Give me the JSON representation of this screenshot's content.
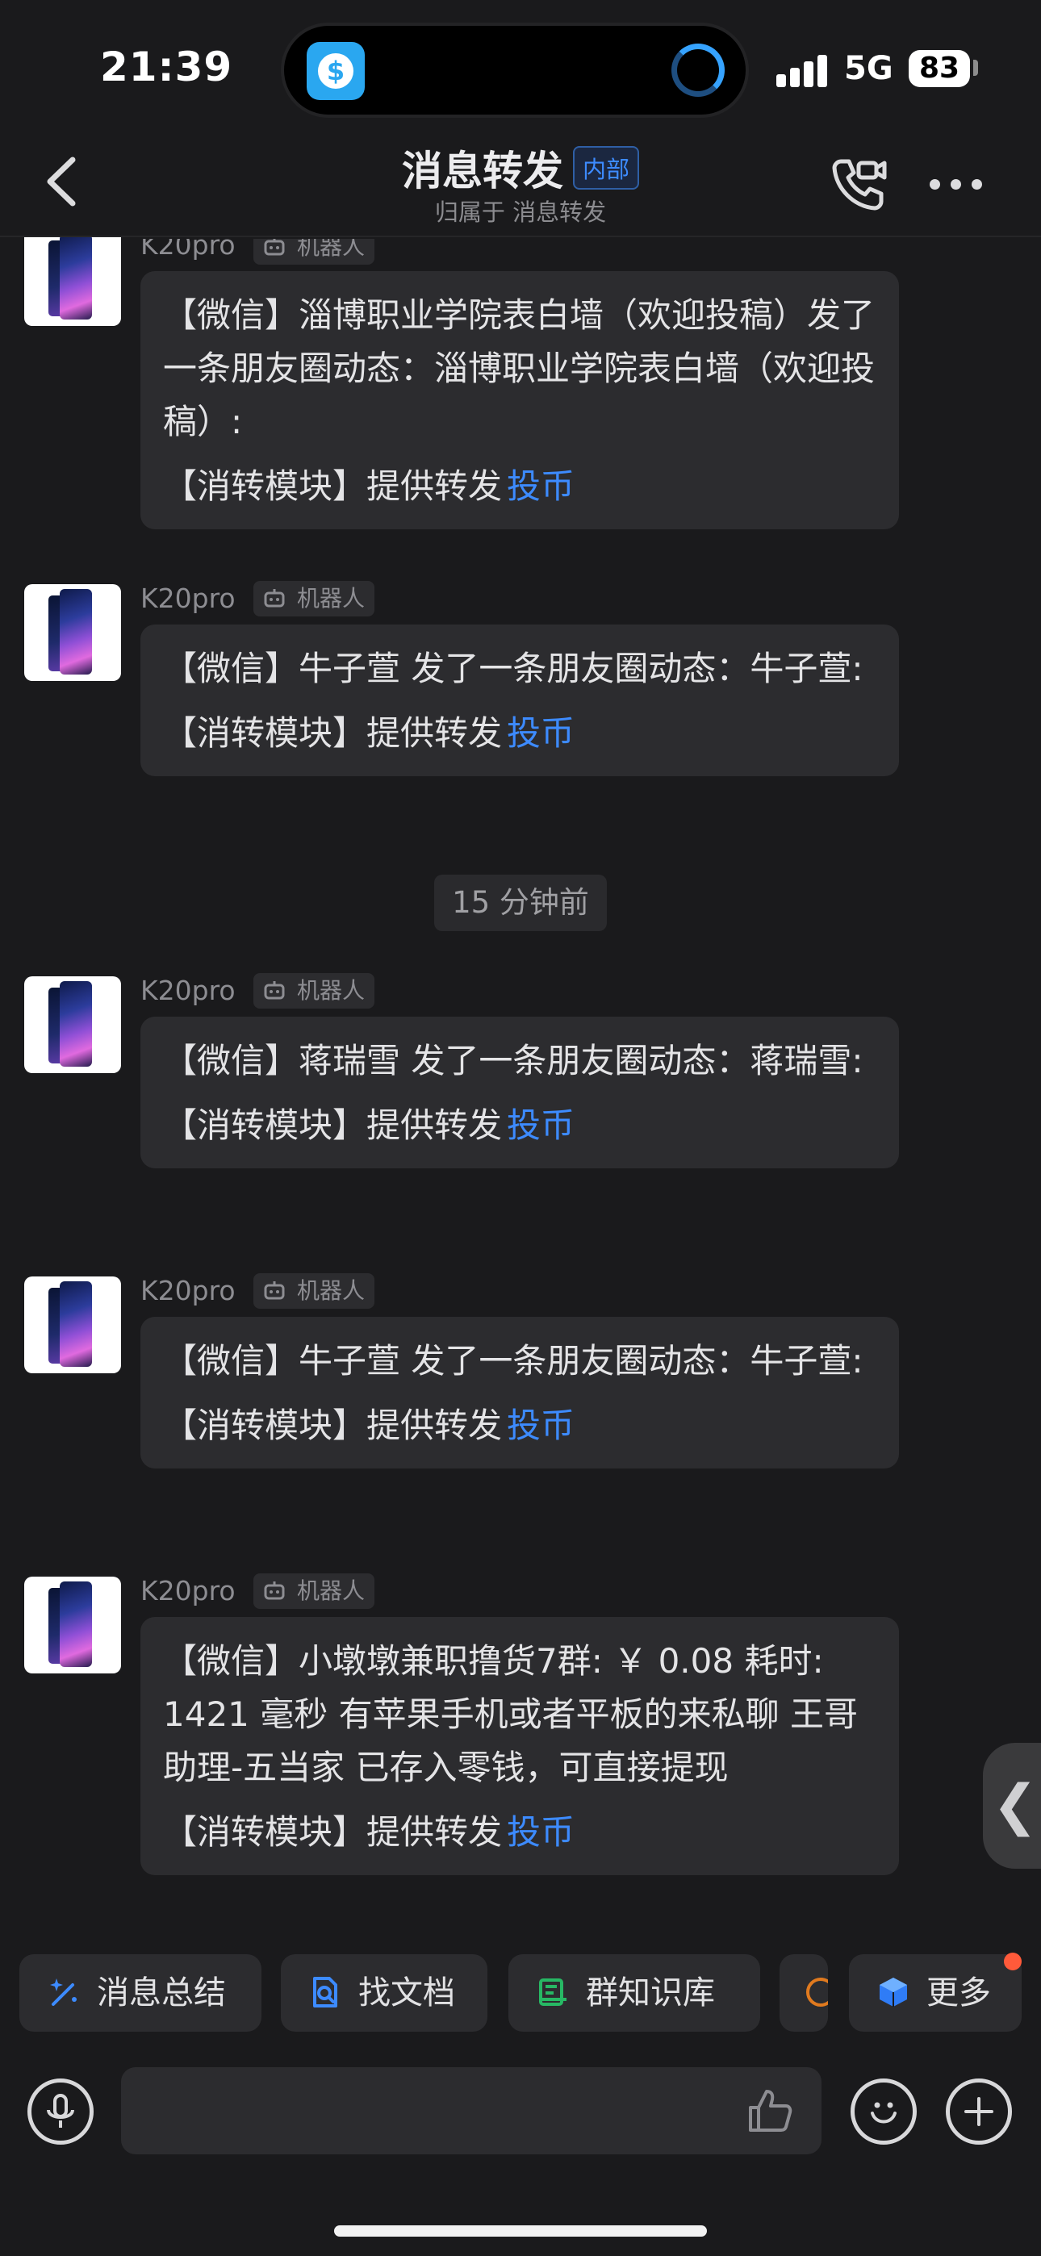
{
  "status": {
    "time": "21:39",
    "network": "5G",
    "battery": "83"
  },
  "nav": {
    "title": "消息转发",
    "badge": "内部",
    "subtitle": "归属于 消息转发"
  },
  "messages": [
    {
      "sender": "K20pro",
      "tag": "机器人",
      "text": "【微信】淄博职业学院表白墙（欢迎投稿）发了一条朋友圈动态：淄博职业学院表白墙（欢迎投稿）:",
      "footer": "【消转模块】提供转发",
      "link": "投币"
    },
    {
      "sender": "K20pro",
      "tag": "机器人",
      "text": "【微信】牛子萱 发了一条朋友圈动态：牛子萱:",
      "footer": "【消转模块】提供转发",
      "link": "投币"
    },
    {
      "sender": "K20pro",
      "tag": "机器人",
      "text": "【微信】蒋瑞雪 发了一条朋友圈动态：蒋瑞雪:",
      "footer": "【消转模块】提供转发",
      "link": "投币"
    },
    {
      "sender": "K20pro",
      "tag": "机器人",
      "text": "【微信】牛子萱 发了一条朋友圈动态：牛子萱:",
      "footer": "【消转模块】提供转发",
      "link": "投币"
    },
    {
      "sender": "K20pro",
      "tag": "机器人",
      "text": "【微信】小墩墩兼职撸货7群: ￥ 0.08 耗时: 1421 毫秒 有苹果手机或者平板的来私聊 王哥助理-五当家 已存入零钱，可直接提现",
      "footer": "【消转模块】提供转发",
      "link": "投币"
    }
  ],
  "timestamp": "15 分钟前",
  "side_tab": "❮",
  "chips": [
    {
      "label": "消息总结",
      "icon": "sparkle-pen-icon"
    },
    {
      "label": "找文档",
      "icon": "doc-search-icon"
    },
    {
      "label": "群知识库",
      "icon": "knowledge-base-icon"
    },
    {
      "label": "更多",
      "icon": "cube-icon"
    }
  ],
  "colors": {
    "accent": "#3d8bff",
    "background": "#1a1a1c",
    "bubble": "#2c2c2f",
    "badge_dot": "#ff5a3a"
  }
}
